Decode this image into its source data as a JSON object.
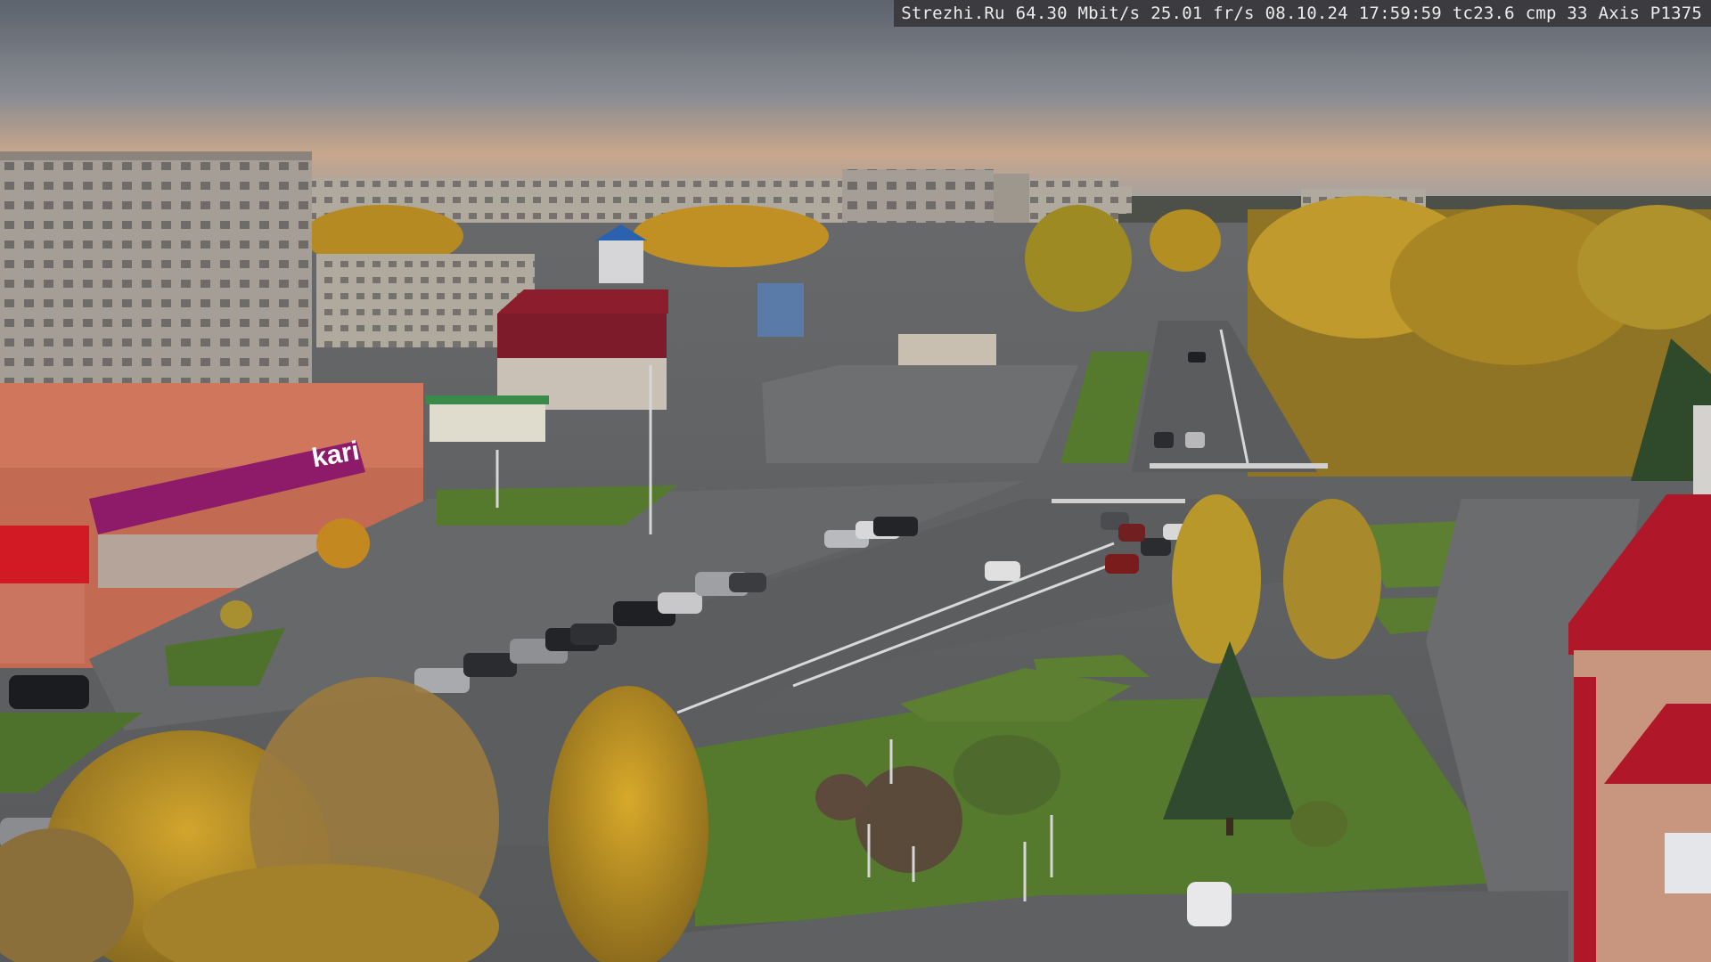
{
  "overlay": {
    "site": "Strezhi.Ru",
    "bitrate": "64.30 Mbit/s",
    "framerate": "25.01 fr/s",
    "date": "08.10.24",
    "time": "17:59:59",
    "tc": "tc23.6",
    "cmp": "cmp 33",
    "camera_model": "Axis P1375"
  },
  "signs": {
    "store_brand": "kari"
  },
  "colors": {
    "sky_top": "#5f6670",
    "sky_glow": "#c9a58a",
    "store_magenta": "#8e1a6a",
    "roof_red": "#b0182a",
    "autumn_yellow": "#c99a1e",
    "grass": "#557a2e",
    "asphalt": "#5e6062"
  }
}
